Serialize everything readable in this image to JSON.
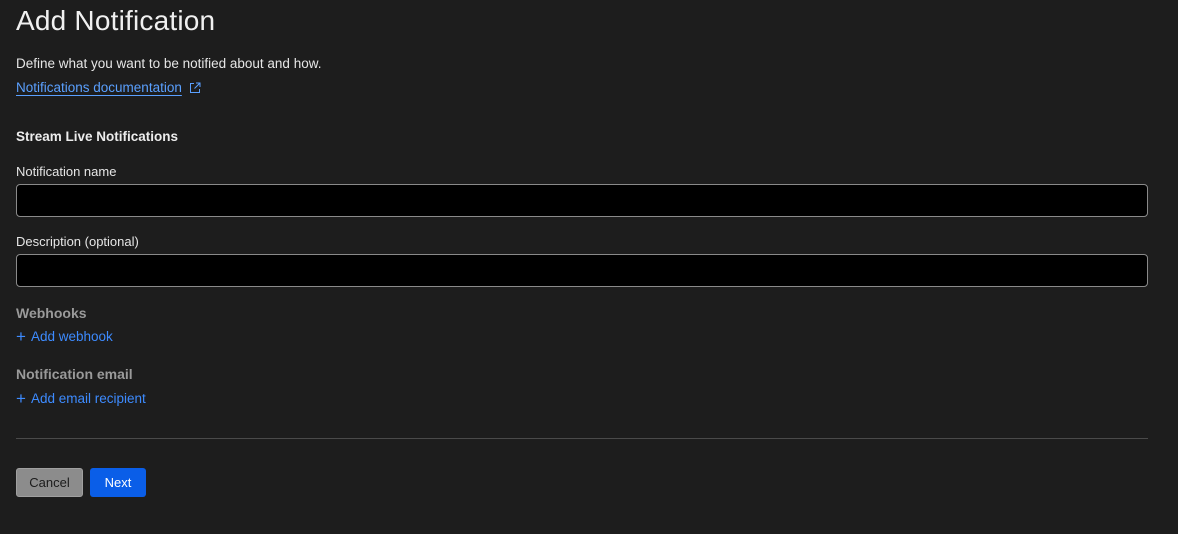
{
  "page": {
    "title": "Add Notification",
    "subtitle": "Define what you want to be notified about and how.",
    "doc_link": "Notifications documentation"
  },
  "form": {
    "section_title": "Stream Live Notifications",
    "name_label": "Notification name",
    "name_value": "",
    "description_label": "Description (optional)",
    "description_value": "",
    "webhooks_label": "Webhooks",
    "add_webhook": "Add webhook",
    "email_label": "Notification email",
    "add_email": "Add email recipient"
  },
  "actions": {
    "cancel": "Cancel",
    "next": "Next"
  },
  "icons": {
    "external_link": "external-link-icon",
    "plus": "plus-icon"
  },
  "colors": {
    "background": "#1d1d1d",
    "link": "#3d8bff",
    "primary_button": "#0a5ee8",
    "secondary_button": "#8c8c8c",
    "input_background": "#000000"
  }
}
